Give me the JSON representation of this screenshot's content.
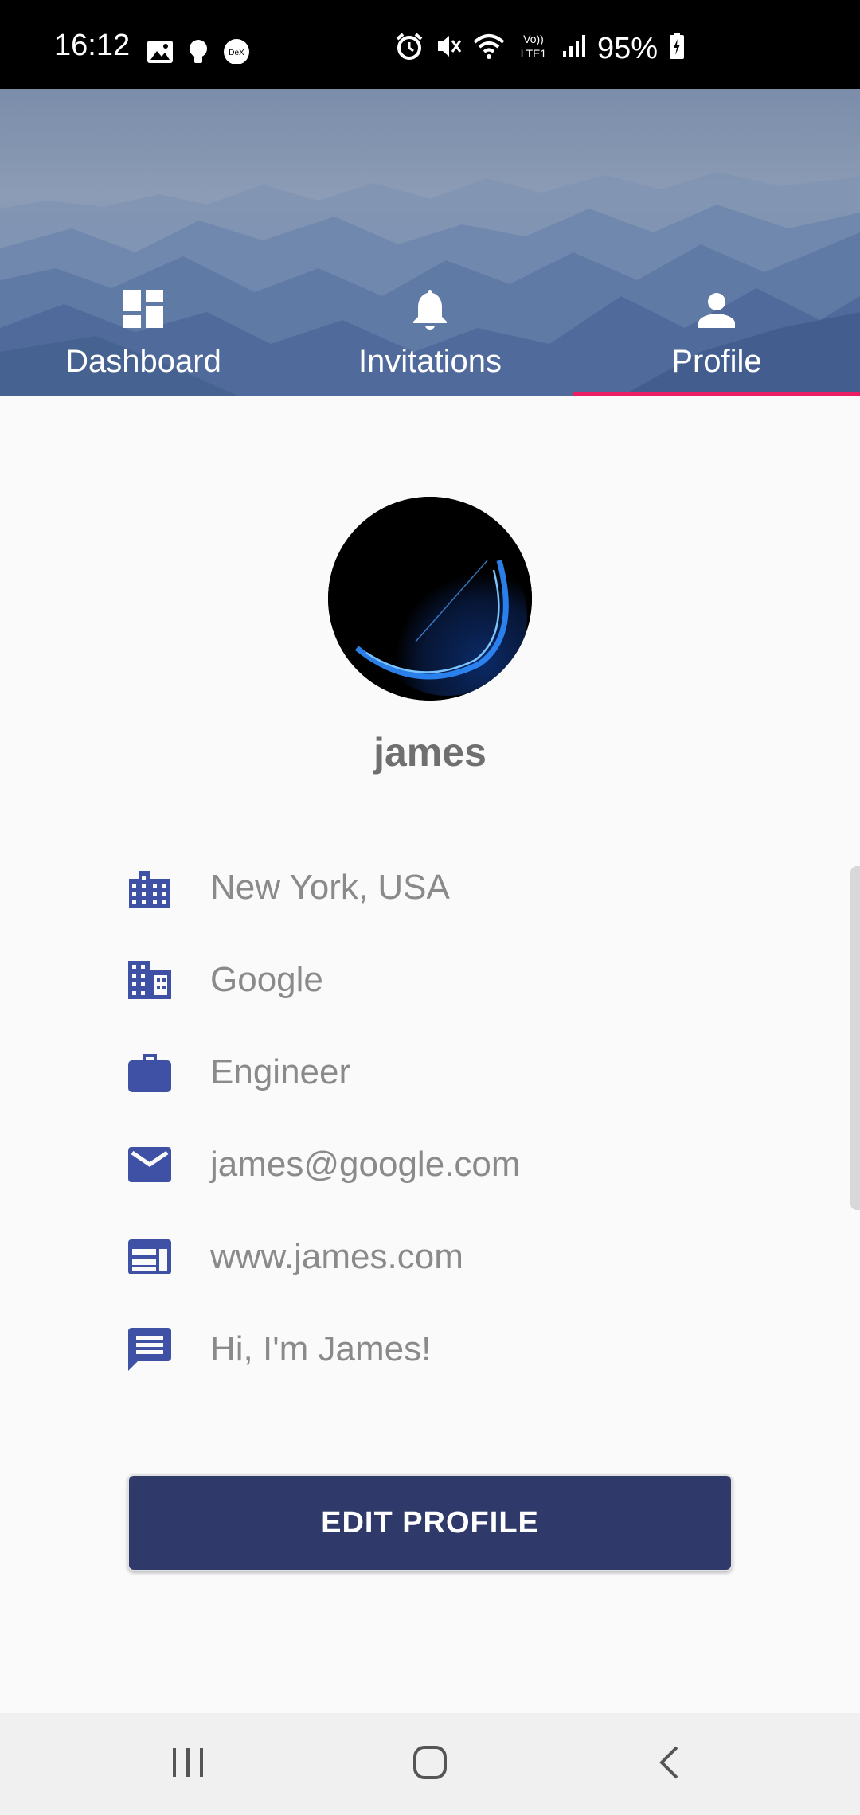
{
  "status_bar": {
    "time": "16:12",
    "battery": "95%",
    "icons": [
      "image-icon",
      "lightbulb-icon",
      "dex-icon",
      "alarm-icon",
      "mute-icon",
      "wifi-icon",
      "volte-icon",
      "signal-icon",
      "battery-charging-icon"
    ],
    "dex_label": "DeX",
    "volte_label_top": "Vo))",
    "volte_label_bottom": "LTE1"
  },
  "tabs": [
    {
      "label": "Dashboard",
      "icon": "dashboard-icon"
    },
    {
      "label": "Invitations",
      "icon": "bell-icon"
    },
    {
      "label": "Profile",
      "icon": "person-icon",
      "selected": true
    }
  ],
  "profile": {
    "username": "james",
    "info": [
      {
        "icon": "city-icon",
        "text": "New York, USA"
      },
      {
        "icon": "office-building-icon",
        "text": "Google"
      },
      {
        "icon": "briefcase-icon",
        "text": "Engineer"
      },
      {
        "icon": "mail-icon",
        "text": "james@google.com"
      },
      {
        "icon": "web-icon",
        "text": "www.james.com"
      },
      {
        "icon": "message-icon",
        "text": "Hi, I'm James!"
      }
    ],
    "edit_button_label": "EDIT PROFILE"
  },
  "nav_bar": {
    "buttons": [
      "recent-apps-icon",
      "home-icon",
      "back-icon"
    ]
  },
  "colors": {
    "accent": "#e91e63",
    "icon_blue": "#3f51a5",
    "button_bg": "#2f3a6b",
    "text_gray": "#8a8a8a"
  }
}
